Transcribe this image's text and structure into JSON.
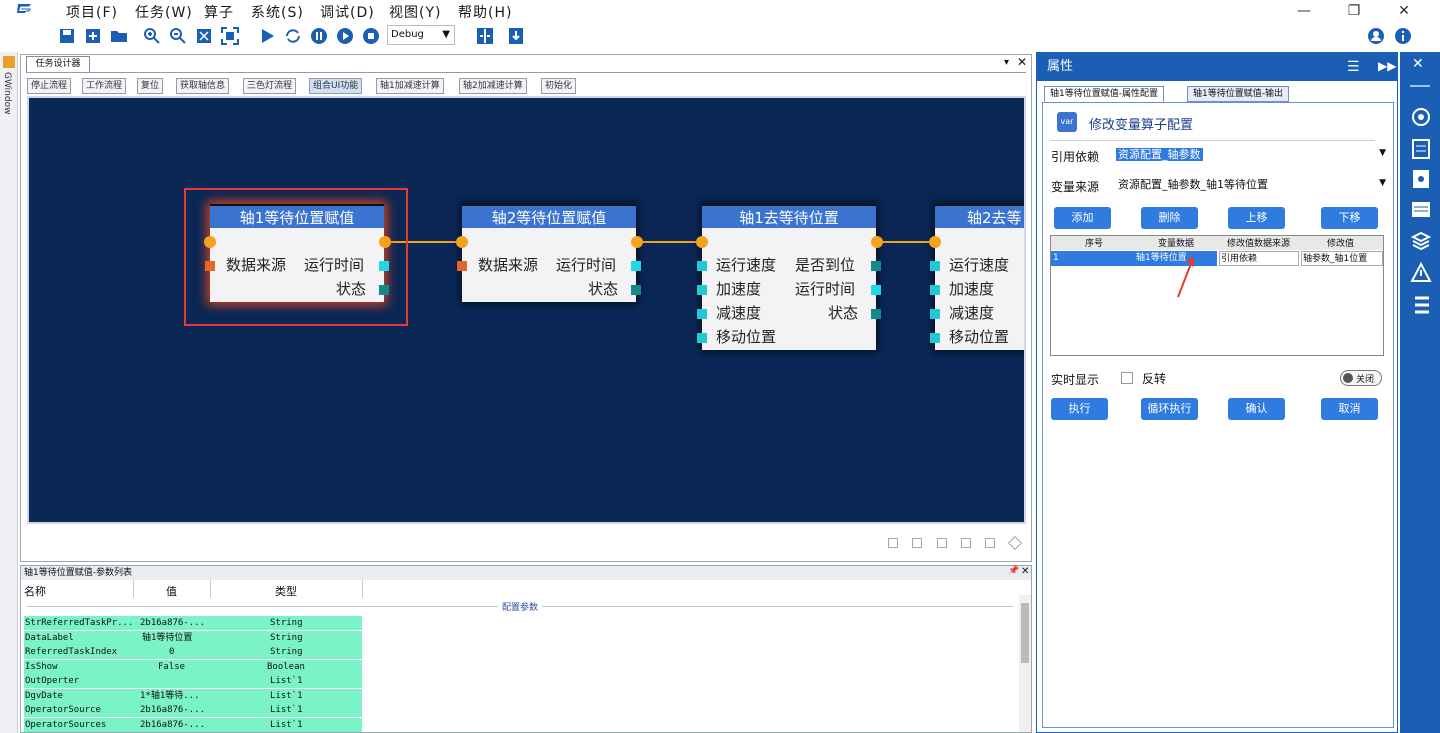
{
  "menu": [
    "项目(F)",
    "任务(W)",
    "算子",
    "系统(S)",
    "调试(D)",
    "视图(Y)",
    "帮助(H)"
  ],
  "toolbar": {
    "mode_value": "Debug"
  },
  "left_strip_label": "GWindow",
  "designer": {
    "tab_label": "任务设计器",
    "subtabs": [
      "停止流程",
      "工作流程",
      "复位",
      "获取轴信息",
      "三色灯流程",
      "组合UI功能",
      "轴1加减速计算",
      "轴2加减速计算",
      "初始化"
    ]
  },
  "nodes": [
    {
      "title": "轴1等待位置赋值",
      "left": [
        "数据来源"
      ],
      "right": [
        "运行时间",
        "状态"
      ]
    },
    {
      "title": "轴2等待位置赋值",
      "left": [
        "数据来源"
      ],
      "right": [
        "运行时间",
        "状态"
      ]
    },
    {
      "title": "轴1去等待位置",
      "left": [
        "运行速度",
        "加速度",
        "减速度",
        "移动位置"
      ],
      "right": [
        "是否到位",
        "运行时间",
        "状态"
      ]
    },
    {
      "title": "轴2去等",
      "left": [
        "运行速度",
        "加速度",
        "减速度",
        "移动位置"
      ],
      "right": []
    }
  ],
  "params": {
    "title": "轴1等待位置赋值-参数列表",
    "headers": [
      "名称",
      "值",
      "类型"
    ],
    "group_label": "配置参数",
    "rows": [
      [
        "StrReferredTaskPr...",
        "2b16a876-...",
        "String"
      ],
      [
        "DataLabel",
        "轴1等待位置",
        "String"
      ],
      [
        "ReferredTaskIndex",
        "0",
        "String"
      ],
      [
        "IsShow",
        "False",
        "Boolean"
      ],
      [
        "OutOperter",
        "",
        "List`1"
      ],
      [
        "DgvDate",
        "1*轴1等待...",
        "List`1"
      ],
      [
        "OperatorSource",
        "2b16a876-...",
        "List`1"
      ],
      [
        "OperatorSources",
        "2b16a876-...",
        "List`1"
      ]
    ]
  },
  "props": {
    "title": "属性",
    "tabs": [
      "轴1等待位置赋值-属性配置",
      "轴1等待位置赋值-输出"
    ],
    "heading": "修改变量算子配置",
    "ref_label": "引用依赖",
    "ref_value": "资源配置_轴参数",
    "src_label": "变量来源",
    "src_value": "资源配置_轴参数_轴1等待位置",
    "buttons": [
      "添加",
      "删除",
      "上移",
      "下移"
    ],
    "table_headers": [
      "序号",
      "变量数据",
      "修改值数据来源",
      "修改值"
    ],
    "table_row": [
      "1",
      "轴1等待位置",
      "引用依赖",
      "轴参数_轴1位置"
    ],
    "realtime_label": "实时显示",
    "invert_label": "反转",
    "toggle_label": "关闭",
    "actions": [
      "执行",
      "循环执行",
      "确认",
      "取消"
    ]
  },
  "colors": {
    "accent": "#1a5fb4",
    "canvas": "#0a2756",
    "node_header": "#3b73d0",
    "wire": "#f6a21a",
    "highlight": "#7af3c6",
    "selection": "#e53935"
  }
}
